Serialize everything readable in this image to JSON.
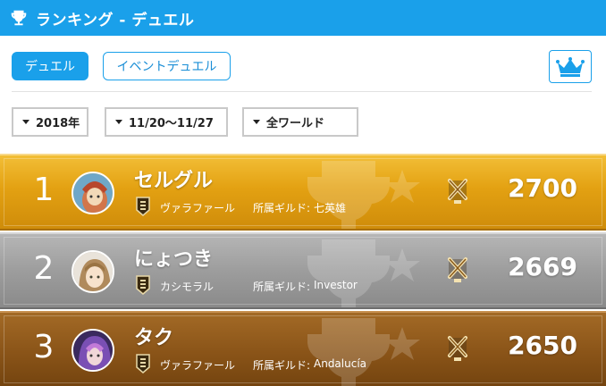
{
  "header": {
    "title": "ランキング - デュエル",
    "icon": "trophy-icon",
    "bg_color": "#1aa0ea"
  },
  "tabs": [
    {
      "label": "デュエル",
      "active": true
    },
    {
      "label": "イベントデュエル",
      "active": false
    }
  ],
  "crown_button": {
    "icon": "crown-icon"
  },
  "filters": {
    "year": "2018年",
    "period": "11/20～11/27",
    "world": "全ワールド"
  },
  "ranking": {
    "guild_label": "所属ギルド:",
    "rows": [
      {
        "rank": "1",
        "name": "セルグル",
        "world": "ヴァラファール",
        "guild": "七英雄",
        "score": "2700",
        "tier": "gold"
      },
      {
        "rank": "2",
        "name": "にょつき",
        "world": "カシモラル",
        "guild": "Investor",
        "score": "2669",
        "tier": "silver"
      },
      {
        "rank": "3",
        "name": "タク",
        "world": "ヴァラファール",
        "guild": "Andalucía",
        "score": "2650",
        "tier": "bronze"
      }
    ]
  }
}
